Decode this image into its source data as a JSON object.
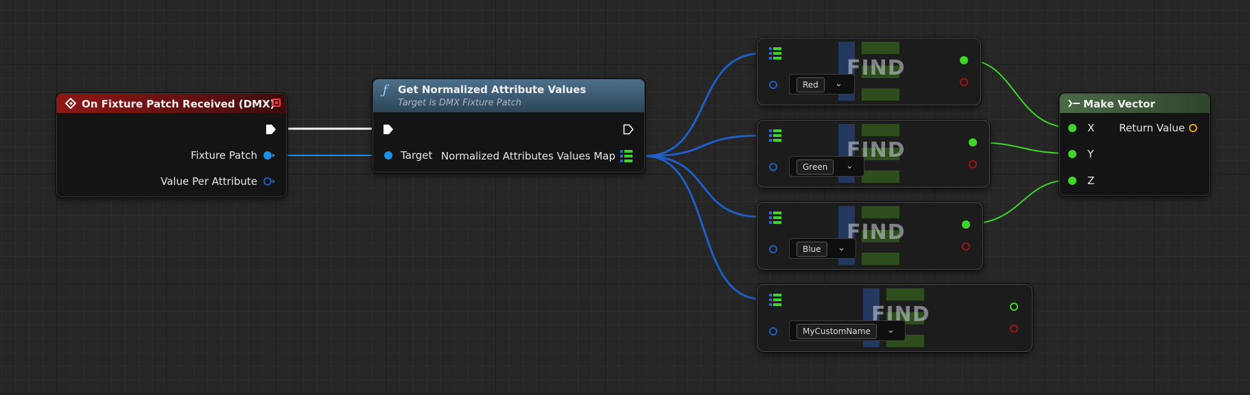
{
  "colors": {
    "event_header": "#7a1414",
    "function_header": "#35536a",
    "vector_header": "#3d5a3a",
    "exec_wire": "#ffffff",
    "object_wire": "#1e90e8",
    "map_wire": "#1e5fc8",
    "float_wire": "#3ed62a"
  },
  "event_node": {
    "title": "On Fixture Patch Received (DMX)",
    "pins": {
      "fixture_patch": "Fixture Patch",
      "value_per_attribute": "Value Per Attribute"
    }
  },
  "function_node": {
    "title": "Get Normalized Attribute Values",
    "subtitle": "Target is DMX Fixture Patch",
    "pins": {
      "target": "Target",
      "output_map": "Normalized Attributes Values Map"
    }
  },
  "find_nodes": [
    {
      "label": "FIND",
      "key": "Red"
    },
    {
      "label": "FIND",
      "key": "Green"
    },
    {
      "label": "FIND",
      "key": "Blue"
    },
    {
      "label": "FIND",
      "key": "MyCustomName"
    }
  ],
  "vector_node": {
    "title": "Make Vector",
    "pins": {
      "x": "X",
      "y": "Y",
      "z": "Z",
      "return_value": "Return Value"
    }
  }
}
